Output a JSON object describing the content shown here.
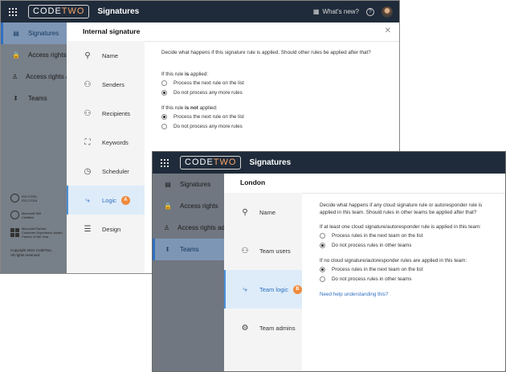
{
  "app": {
    "logo_part1": "CODE",
    "logo_part2": "TWO",
    "title": "Signatures",
    "whats_new": "What's new?",
    "help": "?"
  },
  "window1": {
    "nav": [
      {
        "label": "Signatures",
        "icon": "signatures-icon",
        "glyph": "▤"
      },
      {
        "label": "Access rights",
        "icon": "lock-icon",
        "glyph": "🔒"
      },
      {
        "label": "Access rights a",
        "icon": "person-icon",
        "glyph": "♙"
      },
      {
        "label": "Teams",
        "icon": "teams-icon",
        "glyph": "ꔪ"
      }
    ],
    "certs": [
      {
        "text": "ISO 27001\nISO 27018"
      },
      {
        "text": "Microsoft 365\nCertified"
      },
      {
        "text": "Microsoft Partner\nCustomer Experience Award\nPartner of the Year"
      }
    ],
    "copyright": "Copyright 2024 CodeTwo.\nAll rights reserved.",
    "panel_title": "Internal signature",
    "subnav": [
      {
        "label": "Name",
        "icon": "signpost-icon",
        "glyph": "⚲",
        "badge": ""
      },
      {
        "label": "Senders",
        "icon": "senders-icon",
        "glyph": "⚇",
        "badge": ""
      },
      {
        "label": "Recipients",
        "icon": "recipients-icon",
        "glyph": "⚇",
        "badge": ""
      },
      {
        "label": "Keywords",
        "icon": "keywords-icon",
        "glyph": "⛶",
        "badge": ""
      },
      {
        "label": "Scheduler",
        "icon": "clock-icon",
        "glyph": "◷",
        "badge": ""
      },
      {
        "label": "Logic",
        "icon": "logic-icon",
        "glyph": "⤷",
        "badge": "A"
      },
      {
        "label": "Design",
        "icon": "design-icon",
        "glyph": "☰",
        "badge": ""
      }
    ],
    "intro": "Decide what happens if this signature rule is applied. Should other rules be applied after that?",
    "applied_prefix": "If this rule ",
    "applied_bold": "is",
    "applied_suffix": " applied:",
    "applied_options": [
      {
        "label": "Process the next rule on the list",
        "selected": false
      },
      {
        "label": "Do not process any more rules",
        "selected": true
      }
    ],
    "not_applied_prefix": "If this rule ",
    "not_applied_bold": "is not",
    "not_applied_suffix": " applied:",
    "not_applied_options": [
      {
        "label": "Process the next rule on the list",
        "selected": true
      },
      {
        "label": "Do not process any more rules",
        "selected": false
      }
    ]
  },
  "window2": {
    "nav": [
      {
        "label": "Signatures",
        "icon": "signatures-icon",
        "glyph": "▤"
      },
      {
        "label": "Access rights",
        "icon": "lock-icon",
        "glyph": "🔒"
      },
      {
        "label": "Access rights adr",
        "icon": "person-icon",
        "glyph": "♙"
      },
      {
        "label": "Teams",
        "icon": "teams-icon",
        "glyph": "ꔪ"
      }
    ],
    "panel_title": "London",
    "subnav": [
      {
        "label": "Name",
        "icon": "signpost-icon",
        "glyph": "⚲",
        "badge": ""
      },
      {
        "label": "Team users",
        "icon": "team-users-icon",
        "glyph": "⚇",
        "badge": ""
      },
      {
        "label": "Team logic",
        "icon": "logic-icon",
        "glyph": "⤷",
        "badge": "B"
      },
      {
        "label": "Team admins",
        "icon": "team-admins-icon",
        "glyph": "⚙",
        "badge": ""
      }
    ],
    "intro": "Decide what happens if any cloud signature rule or autoresponder rule is applied in this team. Should rules in other teams be applied after that?",
    "q1": "If at least one cloud signature/autoresponder rule is applied in this team:",
    "q1_options": [
      {
        "label": "Process rules in the next team on the list",
        "selected": false
      },
      {
        "label": "Do not process rules in other teams",
        "selected": true
      }
    ],
    "q2": "If no cloud signature/autoresponder rules are applied in this team:",
    "q2_options": [
      {
        "label": "Process rules in the next team on the list",
        "selected": true
      },
      {
        "label": "Do not process rules in other teams",
        "selected": false
      }
    ],
    "help_link": "Need help understanding this?"
  },
  "colors": {
    "topbar": "#1f2b3a",
    "accent": "#2f6fc0",
    "badge": "#f08a3c",
    "overlay_nav": "#777f88"
  }
}
